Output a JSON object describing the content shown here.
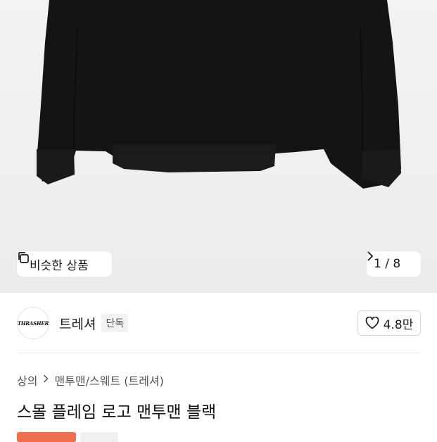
{
  "gallery": {
    "similar_label": "비슷한 상품",
    "page_indicator": "1 / 8"
  },
  "seller": {
    "logo_text": "THRASHER",
    "name": "트레셔",
    "exclusive_badge": "단독",
    "likes": "4.8만"
  },
  "breadcrumb": {
    "category": "상의",
    "subcategory": "맨투맨/스웨트 (트레셔)"
  },
  "product": {
    "title": "스몰 플레임 로고 맨투맨 블랙"
  },
  "colors": {
    "accent_sale": "#ef6e4e",
    "garment": "#141414"
  }
}
